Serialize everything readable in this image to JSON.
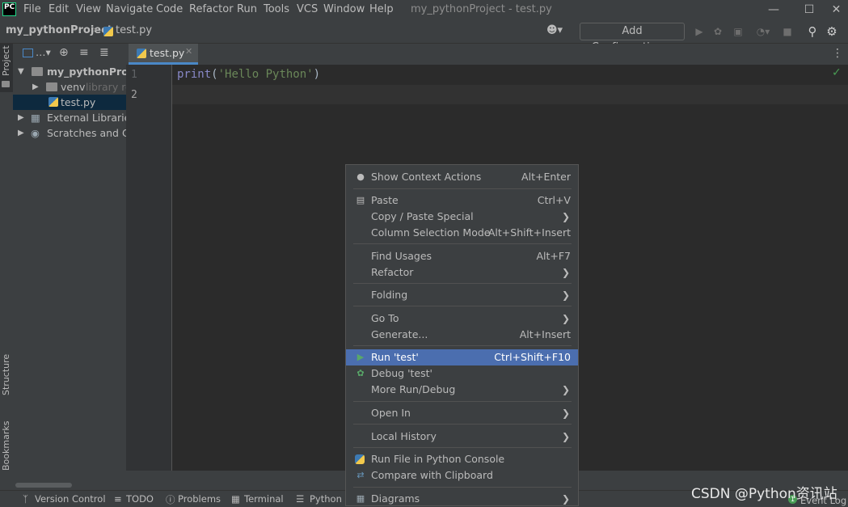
{
  "menubar": {
    "items": [
      "File",
      "Edit",
      "View",
      "Navigate",
      "Code",
      "Refactor",
      "Run",
      "Tools",
      "VCS",
      "Window",
      "Help"
    ],
    "window_title": "my_pythonProject - test.py",
    "logo_text": "PC"
  },
  "navbar": {
    "project": "my_pythonProject",
    "file": "test.py",
    "add_configuration": "Add Configuration..."
  },
  "left_stripe": {
    "project": "Project",
    "structure": "Structure",
    "bookmarks": "Bookmarks"
  },
  "project_tree": {
    "root": "my_pythonProject",
    "venv": "venv",
    "venv_hint": "library root",
    "file": "test.py",
    "external": "External Libraries",
    "scratches": "Scratches and Consoles"
  },
  "editor": {
    "tab": "test.py",
    "line_numbers": [
      "1",
      "2"
    ],
    "code_fn": "print",
    "code_open": "(",
    "code_str": "'Hello Python'",
    "code_close": ")"
  },
  "context_menu": {
    "show_context_actions": {
      "label": "Show Context Actions",
      "shortcut": "Alt+Enter"
    },
    "paste": {
      "label": "Paste",
      "shortcut": "Ctrl+V"
    },
    "copy_paste_special": {
      "label": "Copy / Paste Special"
    },
    "column_selection_mode": {
      "label": "Column Selection Mode",
      "shortcut": "Alt+Shift+Insert"
    },
    "find_usages": {
      "label": "Find Usages",
      "shortcut": "Alt+F7"
    },
    "refactor": {
      "label": "Refactor"
    },
    "folding": {
      "label": "Folding"
    },
    "go_to": {
      "label": "Go To"
    },
    "generate": {
      "label": "Generate...",
      "shortcut": "Alt+Insert"
    },
    "run_test": {
      "label": "Run 'test'",
      "shortcut": "Ctrl+Shift+F10"
    },
    "debug_test": {
      "label": "Debug 'test'"
    },
    "more_run_debug": {
      "label": "More Run/Debug"
    },
    "open_in": {
      "label": "Open In"
    },
    "local_history": {
      "label": "Local History"
    },
    "run_in_console": {
      "label": "Run File in Python Console"
    },
    "compare_clipboard": {
      "label": "Compare with Clipboard"
    },
    "diagrams": {
      "label": "Diagrams"
    }
  },
  "statusbar": {
    "version_control": "Version Control",
    "todo": "TODO",
    "problems": "Problems",
    "terminal": "Terminal",
    "python_packages": "Python P",
    "event_log": "Event Log",
    "event_count": "1"
  },
  "watermark": "CSDN @Python资讯站",
  "colors": {
    "accent": "#4b6eaf",
    "run_green": "#499c54",
    "string_green": "#6a8759",
    "builtin_purple": "#8888c6"
  }
}
